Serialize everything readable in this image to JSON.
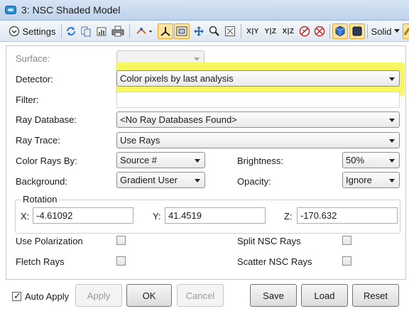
{
  "window": {
    "title": "3: NSC Shaded Model"
  },
  "toolbar": {
    "settings_label": "Settings",
    "solid_label": "Solid",
    "xy_label": "X|Y",
    "yz_label": "Y|Z",
    "xz_label": "X|Z"
  },
  "form": {
    "surface": {
      "label": "Surface:",
      "value": ""
    },
    "detector": {
      "label": "Detector:",
      "value": "Color pixels by last analysis"
    },
    "filter": {
      "label": "Filter:",
      "value": ""
    },
    "ray_database": {
      "label": "Ray Database:",
      "value": "<No Ray Databases Found>"
    },
    "ray_trace": {
      "label": "Ray Trace:",
      "value": "Use Rays"
    },
    "color_rays_by": {
      "label": "Color Rays By:",
      "value": "Source #"
    },
    "brightness": {
      "label": "Brightness:",
      "value": "50%"
    },
    "background": {
      "label": "Background:",
      "value": "Gradient User"
    },
    "opacity": {
      "label": "Opacity:",
      "value": "Ignore"
    },
    "rotation": {
      "title": "Rotation",
      "x_label": "X:",
      "x_value": "-4.61092",
      "y_label": "Y:",
      "y_value": "41.4519",
      "z_label": "Z:",
      "z_value": "-170.632"
    },
    "use_polarization": {
      "label": "Use Polarization",
      "checked": false
    },
    "split_nsc_rays": {
      "label": "Split NSC Rays",
      "checked": false
    },
    "fletch_rays": {
      "label": "Fletch Rays",
      "checked": false
    },
    "scatter_nsc_rays": {
      "label": "Scatter NSC Rays",
      "checked": false
    }
  },
  "buttons": {
    "auto_apply": {
      "label": "Auto Apply",
      "checked": true
    },
    "apply": "Apply",
    "ok": "OK",
    "cancel": "Cancel",
    "save": "Save",
    "load": "Load",
    "reset": "Reset"
  },
  "colors": {
    "highlight": "#f7f760",
    "title_bar": "#c8daf0",
    "accent_active": "#fbe3a0"
  }
}
